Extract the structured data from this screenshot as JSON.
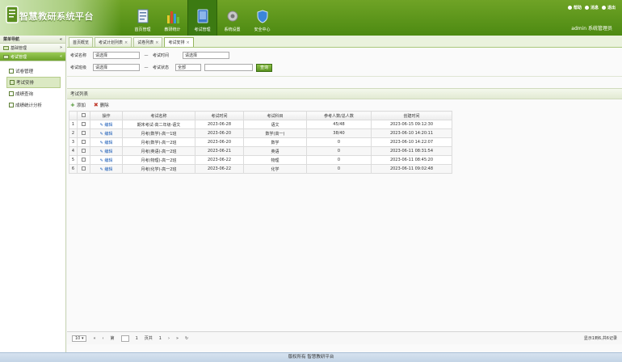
{
  "header": {
    "title": "智慧教研系统平台",
    "nav": [
      {
        "label": "首页管理",
        "icon": "document-icon",
        "active": false
      },
      {
        "label": "教研统计",
        "icon": "bar-chart-icon",
        "active": false
      },
      {
        "label": "考试管理",
        "icon": "book-icon",
        "active": true
      },
      {
        "label": "系统设置",
        "icon": "gear-icon",
        "active": false
      },
      {
        "label": "安全中心",
        "icon": "shield-icon",
        "active": false
      }
    ],
    "top_links": [
      "帮助",
      "消息",
      "退出"
    ],
    "user_info": "admin 系统管理员"
  },
  "sidebar": {
    "title": "菜单导航",
    "groups": [
      {
        "label": "基础管理",
        "open": false
      },
      {
        "label": "考试管理",
        "open": true
      }
    ],
    "items": [
      {
        "label": "试卷管理",
        "active": false
      },
      {
        "label": "考试安排",
        "active": true
      },
      {
        "label": "成绩查询",
        "active": false
      },
      {
        "label": "成绩统计分析",
        "active": false
      }
    ]
  },
  "tabs": [
    {
      "label": "首页概览"
    },
    {
      "label": "考试计划列表"
    },
    {
      "label": "试卷列表"
    },
    {
      "label": "考试安排",
      "active": true
    }
  ],
  "search": {
    "row1": {
      "label1": "考试名称",
      "value1": "请选择",
      "label2": "考试时间",
      "value2": "请选择"
    },
    "row2": {
      "label1": "考试班级",
      "value1": "请选择",
      "label2": "考试状态",
      "select": "全部",
      "button": "查询"
    }
  },
  "panel": {
    "title": "考试列表",
    "add_label": "添加",
    "delete_label": "删除"
  },
  "table": {
    "headers": [
      "",
      "",
      "操作",
      "考试名称",
      "考试时间",
      "考试科目",
      "参考人数/总人数",
      "创建时间"
    ],
    "rows": [
      {
        "num": "1",
        "action": "编辑",
        "name": "期末考试-高二年级-语文",
        "time": "2023-06-28",
        "subject": "语文",
        "count": "45/48",
        "created": "2023-06-15 09:12:30"
      },
      {
        "num": "2",
        "action": "编辑",
        "name": "月考(数学)-高一1班",
        "time": "2023-06-20",
        "subject": "数学(高一)",
        "count": "38/40",
        "created": "2023-06-10 14:20:11"
      },
      {
        "num": "3",
        "action": "编辑",
        "name": "月考(数学)-高一2班",
        "time": "2023-06-20",
        "subject": "数学",
        "count": "0",
        "created": "2023-06-10 14:22:07"
      },
      {
        "num": "4",
        "action": "编辑",
        "name": "月考(英语)-高一2班",
        "time": "2023-06-21",
        "subject": "英语",
        "count": "0",
        "created": "2023-06-11 08:31:54"
      },
      {
        "num": "5",
        "action": "编辑",
        "name": "月考(物理)-高一2班",
        "time": "2023-06-22",
        "subject": "物理",
        "count": "0",
        "created": "2023-06-11 08:45:20"
      },
      {
        "num": "6",
        "action": "编辑",
        "name": "月考(化学)-高一2班",
        "time": "2023-06-22",
        "subject": "化学",
        "count": "0",
        "created": "2023-06-11 09:02:48"
      }
    ]
  },
  "pager": {
    "page_size": "10",
    "page_label_pre": "第",
    "page_value": "1",
    "page_label_post": "页共",
    "total_pages": "1",
    "info": "显示1到6,共6记录"
  },
  "footer": "版权所有 智慧教研平台"
}
